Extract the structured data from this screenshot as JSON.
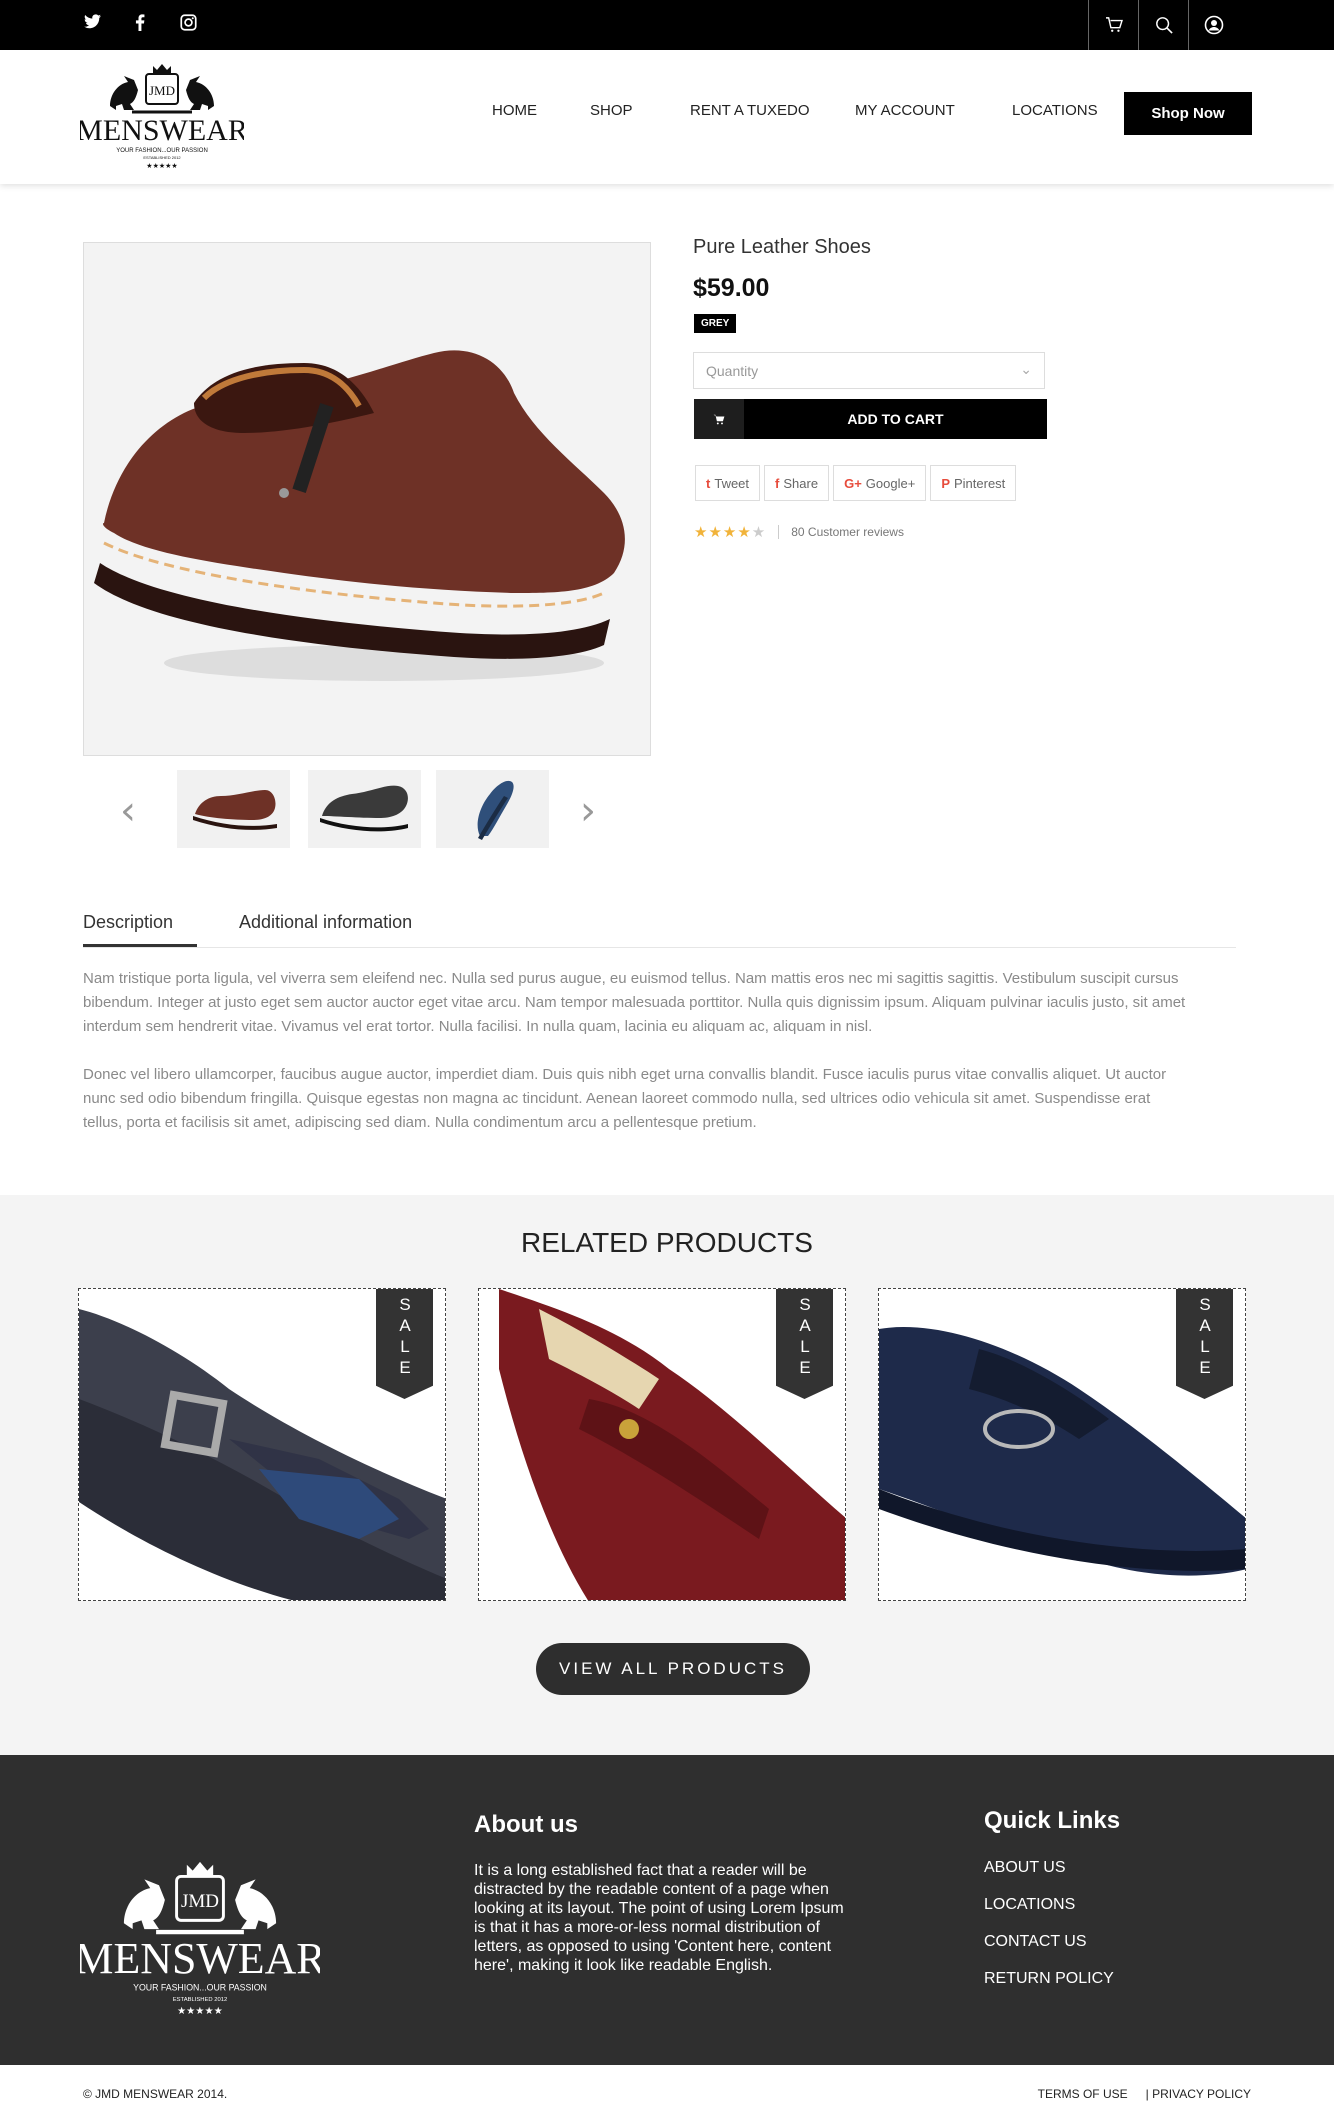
{
  "topbar": {
    "social": [
      "twitter-icon",
      "facebook-icon",
      "instagram-icon"
    ],
    "tools": [
      "cart-icon",
      "search-icon",
      "user-icon"
    ]
  },
  "brand": {
    "name": "MENSWEAR",
    "monogram": "JMD",
    "tagline": "YOUR FASHION...OUR PASSION",
    "established": "ESTABLISHED 2012"
  },
  "nav": {
    "items": [
      "HOME",
      "SHOP",
      "RENT A TUXEDO",
      "MY ACCOUNT",
      "LOCATIONS"
    ],
    "cta": "Shop Now"
  },
  "product": {
    "title": "Pure Leather Shoes",
    "price": "$59.00",
    "color_badge": "GREY",
    "quantity_placeholder": "Quantity",
    "add_to_cart": "ADD TO CART",
    "share": {
      "tweet": "Tweet",
      "share": "Share",
      "google": "Google+",
      "pinterest": "Pinterest"
    },
    "rating": 4,
    "rating_max": 5,
    "reviews": "80 Customer reviews"
  },
  "tabs": {
    "description": "Description",
    "additional": "Additional information"
  },
  "description": {
    "p1": "Nam tristique porta ligula, vel viverra sem eleifend nec. Nulla sed purus augue, eu euismod tellus. Nam mattis eros nec mi sagittis sagittis. Vestibulum suscipit cursus bibendum. Integer at justo eget sem auctor auctor eget vitae arcu. Nam tempor malesuada porttitor. Nulla quis dignissim ipsum. Aliquam pulvinar iaculis justo, sit amet interdum sem hendrerit vitae. Vivamus vel erat tortor. Nulla facilisi. In nulla quam, lacinia eu aliquam ac, aliquam in nisl.",
    "p2": "Donec vel libero ullamcorper, faucibus augue auctor, imperdiet diam. Duis quis nibh eget urna convallis blandit. Fusce iaculis purus vitae convallis aliquet. Ut auctor nunc sed odio bibendum fringilla. Quisque egestas non magna ac tincidunt. Aenean laoreet commodo nulla, sed ultrices odio vehicula sit amet. Suspendisse erat tellus, porta et facilisis sit amet, adipiscing sed diam. Nulla condimentum arcu a pellentesque pretium."
  },
  "related": {
    "heading": "RELATED PRODUCTS",
    "sale": "SALE",
    "view_all": "VIEW ALL PRODUCTS"
  },
  "footer": {
    "about_title": "About us",
    "about_text": "It is a long established fact that a reader will be distracted by the readable content of a page when looking at its layout. The point of using Lorem Ipsum is that it has a more-or-less normal distribution of letters, as opposed to using 'Content here, content here', making it look like readable English.",
    "quick_title": "Quick Links",
    "quick_links": [
      "ABOUT US",
      "LOCATIONS",
      "CONTACT US",
      "RETURN POLICY"
    ]
  },
  "bottom": {
    "copyright": "© JMD MENSWEAR 2014.",
    "terms": "TERMS OF USE",
    "privacy": "| PRIVACY POLICY"
  },
  "colors": {
    "primary": "#000000",
    "footer": "#2f2f2f",
    "star": "#f1b33a",
    "share_icon": "#e74c3c"
  }
}
